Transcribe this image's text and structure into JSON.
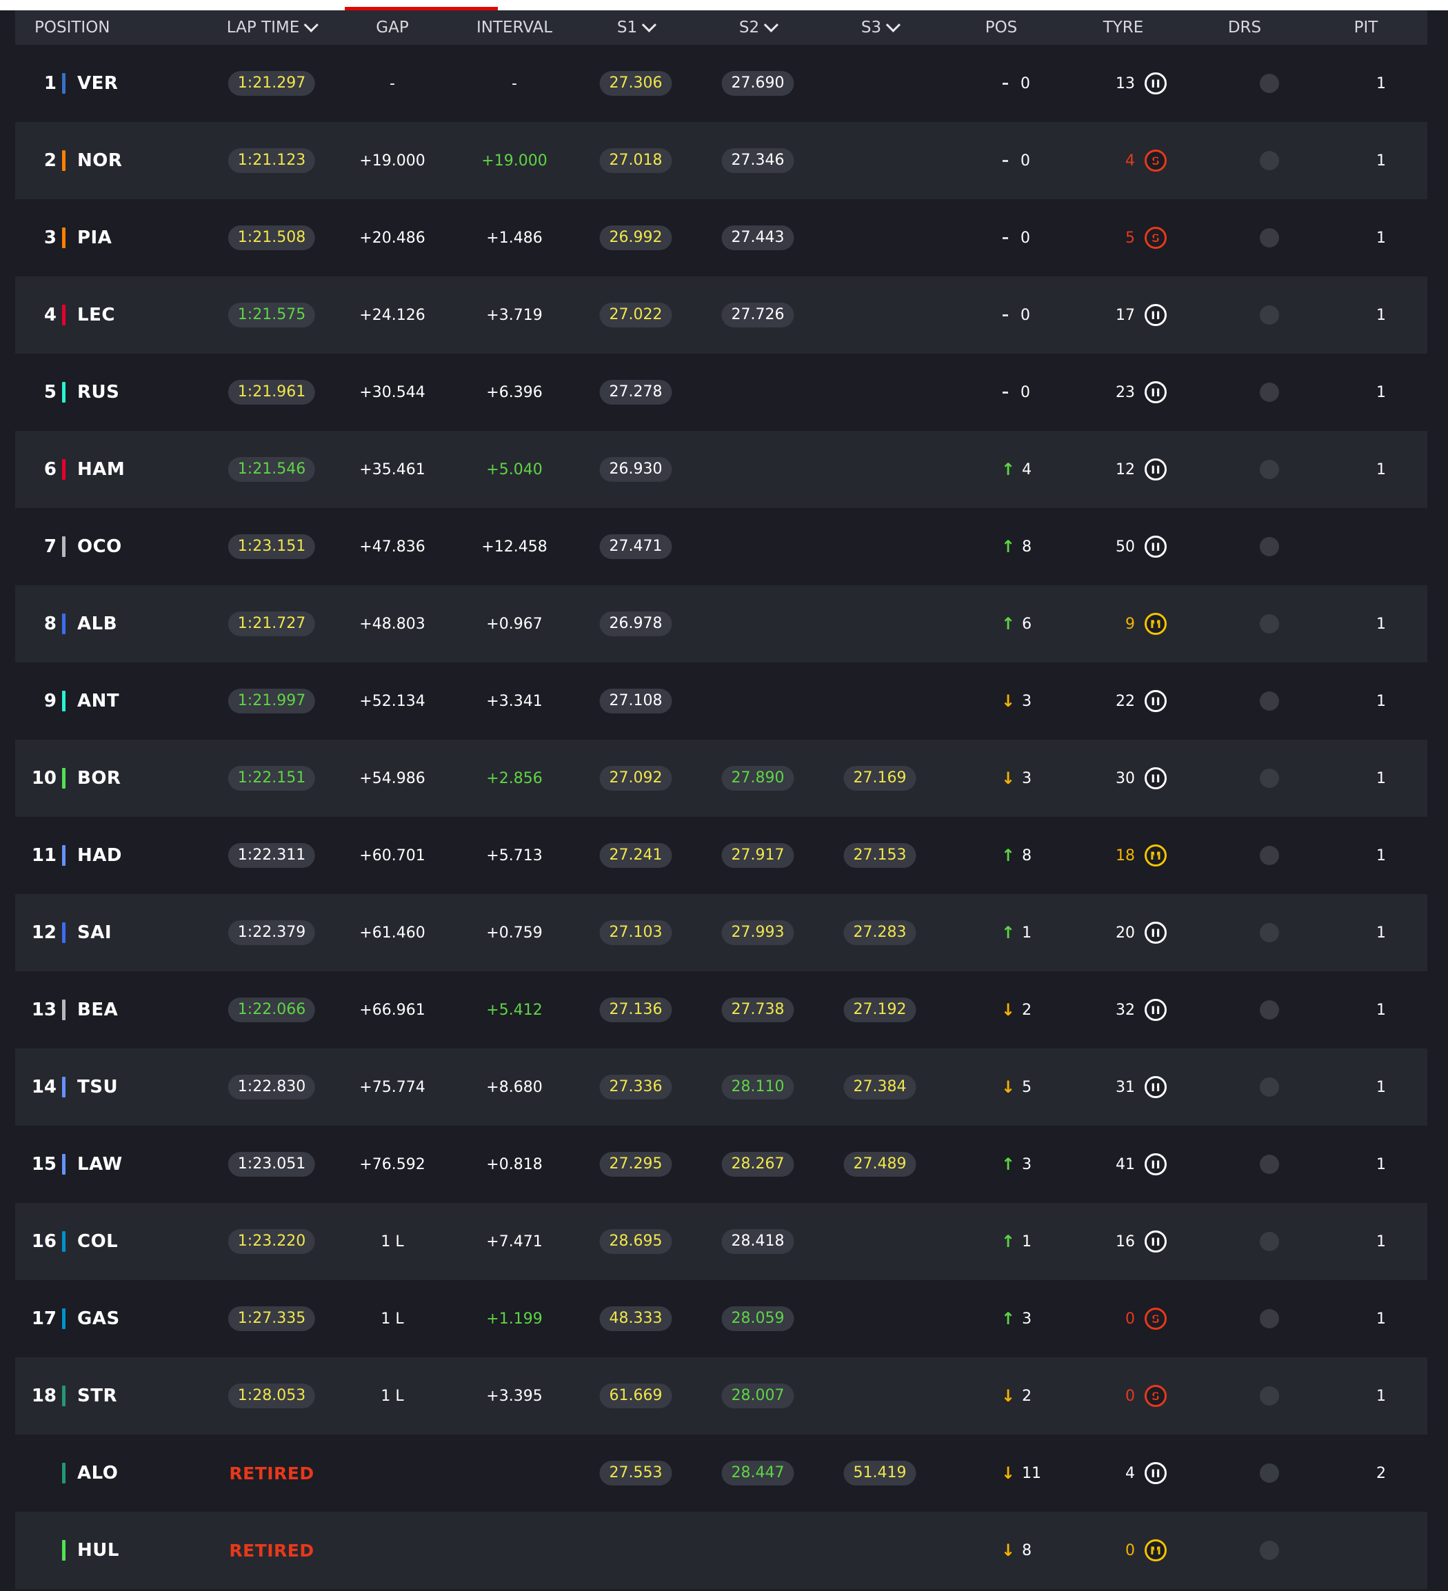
{
  "header": {
    "position": "POSITION",
    "lap_time": "LAP TIME",
    "gap": "GAP",
    "interval": "INTERVAL",
    "s1": "S1",
    "s2": "S2",
    "s3": "S3",
    "pos": "POS",
    "tyre": "TYRE",
    "drs": "DRS",
    "pit": "PIT"
  },
  "colors": {
    "background": "#1b1c24",
    "row_alt": "#262830",
    "header_bg": "#292b34",
    "yellow": "#f0e74a",
    "green": "#5ed544",
    "red": "#e8391a",
    "orange": "#f5b400",
    "accent": "#e10600"
  },
  "rows": [
    {
      "pos": "1",
      "driver": "VER",
      "team_color": "#3671c6",
      "lap_time": "1:21.297",
      "lap_color": "y",
      "gap": "-",
      "interval": "-",
      "interval_color": "w",
      "s1": "27.306",
      "s1_color": "y",
      "s2": "27.690",
      "s2_color": "w",
      "s3": "",
      "s3_color": "w",
      "pos_dir": "same",
      "pos_change": "0",
      "tyre_age": "13",
      "tyre_age_color": "w",
      "tyre": "H",
      "drs": "off",
      "pit": "1"
    },
    {
      "pos": "2",
      "driver": "NOR",
      "team_color": "#ff8000",
      "lap_time": "1:21.123",
      "lap_color": "y",
      "gap": "+19.000",
      "interval": "+19.000",
      "interval_color": "g",
      "s1": "27.018",
      "s1_color": "y",
      "s2": "27.346",
      "s2_color": "w",
      "s3": "",
      "s3_color": "w",
      "pos_dir": "same",
      "pos_change": "0",
      "tyre_age": "4",
      "tyre_age_color": "r",
      "tyre": "S",
      "drs": "off",
      "pit": "1"
    },
    {
      "pos": "3",
      "driver": "PIA",
      "team_color": "#ff8000",
      "lap_time": "1:21.508",
      "lap_color": "y",
      "gap": "+20.486",
      "interval": "+1.486",
      "interval_color": "w",
      "s1": "26.992",
      "s1_color": "y",
      "s2": "27.443",
      "s2_color": "w",
      "s3": "",
      "s3_color": "w",
      "pos_dir": "same",
      "pos_change": "0",
      "tyre_age": "5",
      "tyre_age_color": "r",
      "tyre": "S",
      "drs": "off",
      "pit": "1"
    },
    {
      "pos": "4",
      "driver": "LEC",
      "team_color": "#e8002d",
      "lap_time": "1:21.575",
      "lap_color": "g",
      "gap": "+24.126",
      "interval": "+3.719",
      "interval_color": "w",
      "s1": "27.022",
      "s1_color": "y",
      "s2": "27.726",
      "s2_color": "w",
      "s3": "",
      "s3_color": "w",
      "pos_dir": "same",
      "pos_change": "0",
      "tyre_age": "17",
      "tyre_age_color": "w",
      "tyre": "H",
      "drs": "off",
      "pit": "1"
    },
    {
      "pos": "5",
      "driver": "RUS",
      "team_color": "#27f4d2",
      "lap_time": "1:21.961",
      "lap_color": "y",
      "gap": "+30.544",
      "interval": "+6.396",
      "interval_color": "w",
      "s1": "27.278",
      "s1_color": "w",
      "s2": "",
      "s2_color": "w",
      "s3": "",
      "s3_color": "w",
      "pos_dir": "same",
      "pos_change": "0",
      "tyre_age": "23",
      "tyre_age_color": "w",
      "tyre": "H",
      "drs": "off",
      "pit": "1"
    },
    {
      "pos": "6",
      "driver": "HAM",
      "team_color": "#e8002d",
      "lap_time": "1:21.546",
      "lap_color": "g",
      "gap": "+35.461",
      "interval": "+5.040",
      "interval_color": "g",
      "s1": "26.930",
      "s1_color": "w",
      "s2": "",
      "s2_color": "w",
      "s3": "",
      "s3_color": "w",
      "pos_dir": "up",
      "pos_change": "4",
      "tyre_age": "12",
      "tyre_age_color": "w",
      "tyre": "H",
      "drs": "off",
      "pit": "1"
    },
    {
      "pos": "7",
      "driver": "OCO",
      "team_color": "#b6babd",
      "lap_time": "1:23.151",
      "lap_color": "y",
      "gap": "+47.836",
      "interval": "+12.458",
      "interval_color": "w",
      "s1": "27.471",
      "s1_color": "w",
      "s2": "",
      "s2_color": "w",
      "s3": "",
      "s3_color": "w",
      "pos_dir": "up",
      "pos_change": "8",
      "tyre_age": "50",
      "tyre_age_color": "w",
      "tyre": "H",
      "drs": "off",
      "pit": ""
    },
    {
      "pos": "8",
      "driver": "ALB",
      "team_color": "#3b6df2",
      "lap_time": "1:21.727",
      "lap_color": "y",
      "gap": "+48.803",
      "interval": "+0.967",
      "interval_color": "w",
      "s1": "26.978",
      "s1_color": "w",
      "s2": "",
      "s2_color": "w",
      "s3": "",
      "s3_color": "w",
      "pos_dir": "up",
      "pos_change": "6",
      "tyre_age": "9",
      "tyre_age_color": "o",
      "tyre": "M",
      "drs": "off",
      "pit": "1"
    },
    {
      "pos": "9",
      "driver": "ANT",
      "team_color": "#27f4d2",
      "lap_time": "1:21.997",
      "lap_color": "g",
      "gap": "+52.134",
      "interval": "+3.341",
      "interval_color": "w",
      "s1": "27.108",
      "s1_color": "w",
      "s2": "",
      "s2_color": "w",
      "s3": "",
      "s3_color": "w",
      "pos_dir": "down",
      "pos_change": "3",
      "tyre_age": "22",
      "tyre_age_color": "w",
      "tyre": "H",
      "drs": "off",
      "pit": "1"
    },
    {
      "pos": "10",
      "driver": "BOR",
      "team_color": "#52e252",
      "lap_time": "1:22.151",
      "lap_color": "g",
      "gap": "+54.986",
      "interval": "+2.856",
      "interval_color": "g",
      "s1": "27.092",
      "s1_color": "y",
      "s2": "27.890",
      "s2_color": "g",
      "s3": "27.169",
      "s3_color": "y",
      "pos_dir": "down",
      "pos_change": "3",
      "tyre_age": "30",
      "tyre_age_color": "w",
      "tyre": "H",
      "drs": "off",
      "pit": "1"
    },
    {
      "pos": "11",
      "driver": "HAD",
      "team_color": "#6692ff",
      "lap_time": "1:22.311",
      "lap_color": "w",
      "gap": "+60.701",
      "interval": "+5.713",
      "interval_color": "w",
      "s1": "27.241",
      "s1_color": "y",
      "s2": "27.917",
      "s2_color": "y",
      "s3": "27.153",
      "s3_color": "y",
      "pos_dir": "up",
      "pos_change": "8",
      "tyre_age": "18",
      "tyre_age_color": "o",
      "tyre": "M",
      "drs": "off",
      "pit": "1"
    },
    {
      "pos": "12",
      "driver": "SAI",
      "team_color": "#3b6df2",
      "lap_time": "1:22.379",
      "lap_color": "w",
      "gap": "+61.460",
      "interval": "+0.759",
      "interval_color": "w",
      "s1": "27.103",
      "s1_color": "y",
      "s2": "27.993",
      "s2_color": "y",
      "s3": "27.283",
      "s3_color": "y",
      "pos_dir": "up",
      "pos_change": "1",
      "tyre_age": "20",
      "tyre_age_color": "w",
      "tyre": "H",
      "drs": "off",
      "pit": "1"
    },
    {
      "pos": "13",
      "driver": "BEA",
      "team_color": "#b6babd",
      "lap_time": "1:22.066",
      "lap_color": "g",
      "gap": "+66.961",
      "interval": "+5.412",
      "interval_color": "g",
      "s1": "27.136",
      "s1_color": "y",
      "s2": "27.738",
      "s2_color": "y",
      "s3": "27.192",
      "s3_color": "y",
      "pos_dir": "down",
      "pos_change": "2",
      "tyre_age": "32",
      "tyre_age_color": "w",
      "tyre": "H",
      "drs": "off",
      "pit": "1"
    },
    {
      "pos": "14",
      "driver": "TSU",
      "team_color": "#6692ff",
      "lap_time": "1:22.830",
      "lap_color": "w",
      "gap": "+75.774",
      "interval": "+8.680",
      "interval_color": "w",
      "s1": "27.336",
      "s1_color": "y",
      "s2": "28.110",
      "s2_color": "g",
      "s3": "27.384",
      "s3_color": "y",
      "pos_dir": "down",
      "pos_change": "5",
      "tyre_age": "31",
      "tyre_age_color": "w",
      "tyre": "H",
      "drs": "off",
      "pit": "1"
    },
    {
      "pos": "15",
      "driver": "LAW",
      "team_color": "#6692ff",
      "lap_time": "1:23.051",
      "lap_color": "w",
      "gap": "+76.592",
      "interval": "+0.818",
      "interval_color": "w",
      "s1": "27.295",
      "s1_color": "y",
      "s2": "28.267",
      "s2_color": "y",
      "s3": "27.489",
      "s3_color": "y",
      "pos_dir": "up",
      "pos_change": "3",
      "tyre_age": "41",
      "tyre_age_color": "w",
      "tyre": "H",
      "drs": "off",
      "pit": "1"
    },
    {
      "pos": "16",
      "driver": "COL",
      "team_color": "#0093cc",
      "lap_time": "1:23.220",
      "lap_color": "y",
      "gap": "1 L",
      "interval": "+7.471",
      "interval_color": "w",
      "s1": "28.695",
      "s1_color": "y",
      "s2": "28.418",
      "s2_color": "w",
      "s3": "",
      "s3_color": "w",
      "pos_dir": "up",
      "pos_change": "1",
      "tyre_age": "16",
      "tyre_age_color": "w",
      "tyre": "H",
      "drs": "off",
      "pit": "1"
    },
    {
      "pos": "17",
      "driver": "GAS",
      "team_color": "#0093cc",
      "lap_time": "1:27.335",
      "lap_color": "y",
      "gap": "1 L",
      "interval": "+1.199",
      "interval_color": "g",
      "s1": "48.333",
      "s1_color": "y",
      "s2": "28.059",
      "s2_color": "g",
      "s3": "",
      "s3_color": "w",
      "pos_dir": "up",
      "pos_change": "3",
      "tyre_age": "0",
      "tyre_age_color": "r",
      "tyre": "S",
      "drs": "off",
      "pit": "1"
    },
    {
      "pos": "18",
      "driver": "STR",
      "team_color": "#229971",
      "lap_time": "1:28.053",
      "lap_color": "y",
      "gap": "1 L",
      "interval": "+3.395",
      "interval_color": "w",
      "s1": "61.669",
      "s1_color": "y",
      "s2": "28.007",
      "s2_color": "g",
      "s3": "",
      "s3_color": "w",
      "pos_dir": "down",
      "pos_change": "2",
      "tyre_age": "0",
      "tyre_age_color": "r",
      "tyre": "S",
      "drs": "off",
      "pit": "1"
    },
    {
      "pos": "",
      "driver": "ALO",
      "team_color": "#229971",
      "lap_time": "RETIRED",
      "lap_color": "retired",
      "gap": "",
      "interval": "",
      "interval_color": "w",
      "s1": "27.553",
      "s1_color": "y",
      "s2": "28.447",
      "s2_color": "g",
      "s3": "51.419",
      "s3_color": "y",
      "pos_dir": "down",
      "pos_change": "11",
      "tyre_age": "4",
      "tyre_age_color": "w",
      "tyre": "H",
      "drs": "off",
      "pit": "2"
    },
    {
      "pos": "",
      "driver": "HUL",
      "team_color": "#52e252",
      "lap_time": "RETIRED",
      "lap_color": "retired",
      "gap": "",
      "interval": "",
      "interval_color": "w",
      "s1": "",
      "s1_color": "w",
      "s2": "",
      "s2_color": "w",
      "s3": "",
      "s3_color": "w",
      "pos_dir": "down",
      "pos_change": "8",
      "tyre_age": "0",
      "tyre_age_color": "o",
      "tyre": "M",
      "drs": "off",
      "pit": ""
    }
  ]
}
